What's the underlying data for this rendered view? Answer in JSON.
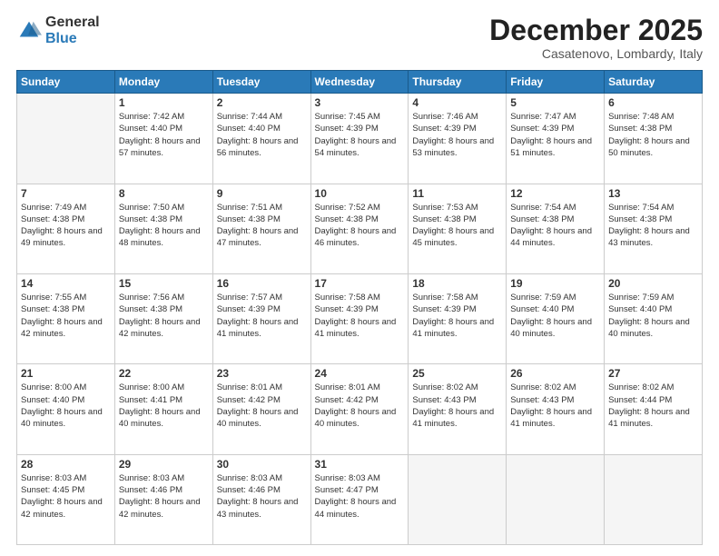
{
  "logo": {
    "general": "General",
    "blue": "Blue"
  },
  "title": "December 2025",
  "location": "Casatenovo, Lombardy, Italy",
  "days_header": [
    "Sunday",
    "Monday",
    "Tuesday",
    "Wednesday",
    "Thursday",
    "Friday",
    "Saturday"
  ],
  "weeks": [
    [
      {
        "day": "",
        "sunrise": "",
        "sunset": "",
        "daylight": ""
      },
      {
        "day": "1",
        "sunrise": "Sunrise: 7:42 AM",
        "sunset": "Sunset: 4:40 PM",
        "daylight": "Daylight: 8 hours and 57 minutes."
      },
      {
        "day": "2",
        "sunrise": "Sunrise: 7:44 AM",
        "sunset": "Sunset: 4:40 PM",
        "daylight": "Daylight: 8 hours and 56 minutes."
      },
      {
        "day": "3",
        "sunrise": "Sunrise: 7:45 AM",
        "sunset": "Sunset: 4:39 PM",
        "daylight": "Daylight: 8 hours and 54 minutes."
      },
      {
        "day": "4",
        "sunrise": "Sunrise: 7:46 AM",
        "sunset": "Sunset: 4:39 PM",
        "daylight": "Daylight: 8 hours and 53 minutes."
      },
      {
        "day": "5",
        "sunrise": "Sunrise: 7:47 AM",
        "sunset": "Sunset: 4:39 PM",
        "daylight": "Daylight: 8 hours and 51 minutes."
      },
      {
        "day": "6",
        "sunrise": "Sunrise: 7:48 AM",
        "sunset": "Sunset: 4:38 PM",
        "daylight": "Daylight: 8 hours and 50 minutes."
      }
    ],
    [
      {
        "day": "7",
        "sunrise": "Sunrise: 7:49 AM",
        "sunset": "Sunset: 4:38 PM",
        "daylight": "Daylight: 8 hours and 49 minutes."
      },
      {
        "day": "8",
        "sunrise": "Sunrise: 7:50 AM",
        "sunset": "Sunset: 4:38 PM",
        "daylight": "Daylight: 8 hours and 48 minutes."
      },
      {
        "day": "9",
        "sunrise": "Sunrise: 7:51 AM",
        "sunset": "Sunset: 4:38 PM",
        "daylight": "Daylight: 8 hours and 47 minutes."
      },
      {
        "day": "10",
        "sunrise": "Sunrise: 7:52 AM",
        "sunset": "Sunset: 4:38 PM",
        "daylight": "Daylight: 8 hours and 46 minutes."
      },
      {
        "day": "11",
        "sunrise": "Sunrise: 7:53 AM",
        "sunset": "Sunset: 4:38 PM",
        "daylight": "Daylight: 8 hours and 45 minutes."
      },
      {
        "day": "12",
        "sunrise": "Sunrise: 7:54 AM",
        "sunset": "Sunset: 4:38 PM",
        "daylight": "Daylight: 8 hours and 44 minutes."
      },
      {
        "day": "13",
        "sunrise": "Sunrise: 7:54 AM",
        "sunset": "Sunset: 4:38 PM",
        "daylight": "Daylight: 8 hours and 43 minutes."
      }
    ],
    [
      {
        "day": "14",
        "sunrise": "Sunrise: 7:55 AM",
        "sunset": "Sunset: 4:38 PM",
        "daylight": "Daylight: 8 hours and 42 minutes."
      },
      {
        "day": "15",
        "sunrise": "Sunrise: 7:56 AM",
        "sunset": "Sunset: 4:38 PM",
        "daylight": "Daylight: 8 hours and 42 minutes."
      },
      {
        "day": "16",
        "sunrise": "Sunrise: 7:57 AM",
        "sunset": "Sunset: 4:39 PM",
        "daylight": "Daylight: 8 hours and 41 minutes."
      },
      {
        "day": "17",
        "sunrise": "Sunrise: 7:58 AM",
        "sunset": "Sunset: 4:39 PM",
        "daylight": "Daylight: 8 hours and 41 minutes."
      },
      {
        "day": "18",
        "sunrise": "Sunrise: 7:58 AM",
        "sunset": "Sunset: 4:39 PM",
        "daylight": "Daylight: 8 hours and 41 minutes."
      },
      {
        "day": "19",
        "sunrise": "Sunrise: 7:59 AM",
        "sunset": "Sunset: 4:40 PM",
        "daylight": "Daylight: 8 hours and 40 minutes."
      },
      {
        "day": "20",
        "sunrise": "Sunrise: 7:59 AM",
        "sunset": "Sunset: 4:40 PM",
        "daylight": "Daylight: 8 hours and 40 minutes."
      }
    ],
    [
      {
        "day": "21",
        "sunrise": "Sunrise: 8:00 AM",
        "sunset": "Sunset: 4:40 PM",
        "daylight": "Daylight: 8 hours and 40 minutes."
      },
      {
        "day": "22",
        "sunrise": "Sunrise: 8:00 AM",
        "sunset": "Sunset: 4:41 PM",
        "daylight": "Daylight: 8 hours and 40 minutes."
      },
      {
        "day": "23",
        "sunrise": "Sunrise: 8:01 AM",
        "sunset": "Sunset: 4:42 PM",
        "daylight": "Daylight: 8 hours and 40 minutes."
      },
      {
        "day": "24",
        "sunrise": "Sunrise: 8:01 AM",
        "sunset": "Sunset: 4:42 PM",
        "daylight": "Daylight: 8 hours and 40 minutes."
      },
      {
        "day": "25",
        "sunrise": "Sunrise: 8:02 AM",
        "sunset": "Sunset: 4:43 PM",
        "daylight": "Daylight: 8 hours and 41 minutes."
      },
      {
        "day": "26",
        "sunrise": "Sunrise: 8:02 AM",
        "sunset": "Sunset: 4:43 PM",
        "daylight": "Daylight: 8 hours and 41 minutes."
      },
      {
        "day": "27",
        "sunrise": "Sunrise: 8:02 AM",
        "sunset": "Sunset: 4:44 PM",
        "daylight": "Daylight: 8 hours and 41 minutes."
      }
    ],
    [
      {
        "day": "28",
        "sunrise": "Sunrise: 8:03 AM",
        "sunset": "Sunset: 4:45 PM",
        "daylight": "Daylight: 8 hours and 42 minutes."
      },
      {
        "day": "29",
        "sunrise": "Sunrise: 8:03 AM",
        "sunset": "Sunset: 4:46 PM",
        "daylight": "Daylight: 8 hours and 42 minutes."
      },
      {
        "day": "30",
        "sunrise": "Sunrise: 8:03 AM",
        "sunset": "Sunset: 4:46 PM",
        "daylight": "Daylight: 8 hours and 43 minutes."
      },
      {
        "day": "31",
        "sunrise": "Sunrise: 8:03 AM",
        "sunset": "Sunset: 4:47 PM",
        "daylight": "Daylight: 8 hours and 44 minutes."
      },
      {
        "day": "",
        "sunrise": "",
        "sunset": "",
        "daylight": ""
      },
      {
        "day": "",
        "sunrise": "",
        "sunset": "",
        "daylight": ""
      },
      {
        "day": "",
        "sunrise": "",
        "sunset": "",
        "daylight": ""
      }
    ]
  ]
}
